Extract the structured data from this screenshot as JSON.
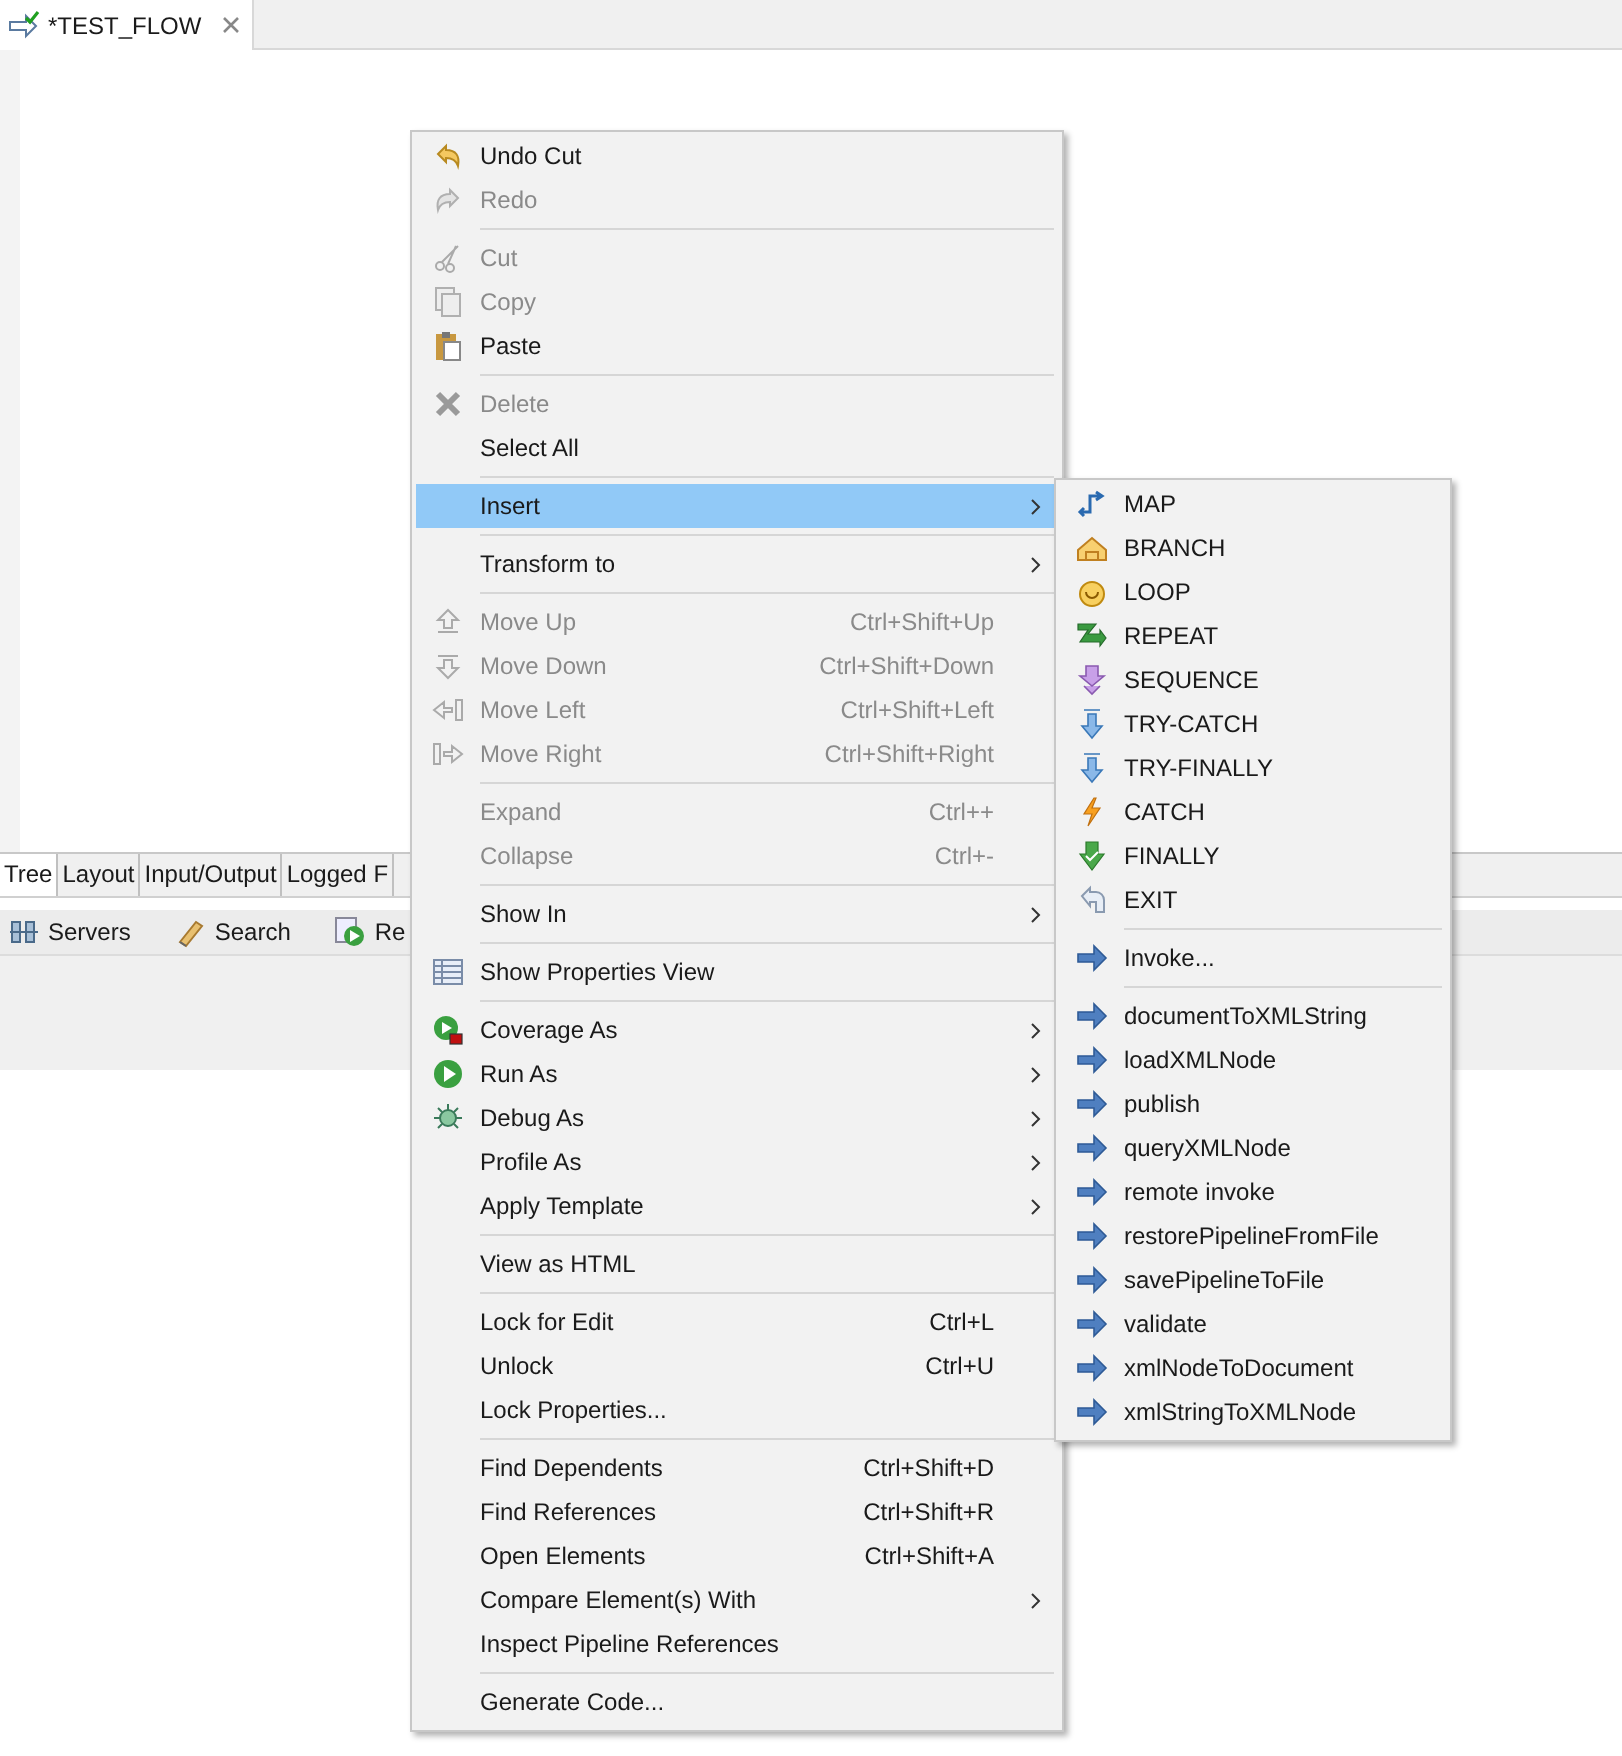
{
  "editor_tab": {
    "title": "*TEST_FLOW",
    "selected": true
  },
  "editor_tabs": [
    {
      "label": "Tree",
      "selected": true
    },
    {
      "label": "Layout",
      "selected": false
    },
    {
      "label": "Input/Output",
      "selected": false
    },
    {
      "label": "Logged F",
      "selected": false
    }
  ],
  "view_tabs": [
    {
      "label": "Servers"
    },
    {
      "label": "Search"
    },
    {
      "label": "Re"
    }
  ],
  "context_menu": [
    {
      "kind": "item",
      "label": "Undo Cut",
      "disabled": false
    },
    {
      "kind": "item",
      "label": "Redo",
      "disabled": true
    },
    {
      "kind": "separator"
    },
    {
      "kind": "item",
      "label": "Cut",
      "disabled": true
    },
    {
      "kind": "item",
      "label": "Copy",
      "disabled": true
    },
    {
      "kind": "item",
      "label": "Paste",
      "disabled": false
    },
    {
      "kind": "separator"
    },
    {
      "kind": "item",
      "label": "Delete",
      "disabled": true
    },
    {
      "kind": "item",
      "label": "Select All",
      "disabled": false
    },
    {
      "kind": "separator"
    },
    {
      "kind": "item",
      "label": "Insert",
      "disabled": false,
      "submenu": true,
      "selected": true
    },
    {
      "kind": "separator"
    },
    {
      "kind": "item",
      "label": "Transform to",
      "disabled": false,
      "submenu": true
    },
    {
      "kind": "separator"
    },
    {
      "kind": "item",
      "label": "Move Up",
      "shortcut": "Ctrl+Shift+Up",
      "disabled": true
    },
    {
      "kind": "item",
      "label": "Move Down",
      "shortcut": "Ctrl+Shift+Down",
      "disabled": true
    },
    {
      "kind": "item",
      "label": "Move Left",
      "shortcut": "Ctrl+Shift+Left",
      "disabled": true
    },
    {
      "kind": "item",
      "label": "Move Right",
      "shortcut": "Ctrl+Shift+Right",
      "disabled": true
    },
    {
      "kind": "separator"
    },
    {
      "kind": "item",
      "label": "Expand",
      "shortcut": "Ctrl++",
      "disabled": true
    },
    {
      "kind": "item",
      "label": "Collapse",
      "shortcut": "Ctrl+-",
      "disabled": true
    },
    {
      "kind": "separator"
    },
    {
      "kind": "item",
      "label": "Show In",
      "disabled": false,
      "submenu": true
    },
    {
      "kind": "separator"
    },
    {
      "kind": "item",
      "label": "Show Properties View",
      "disabled": false
    },
    {
      "kind": "separator"
    },
    {
      "kind": "item",
      "label": "Coverage As",
      "disabled": false,
      "submenu": true
    },
    {
      "kind": "item",
      "label": "Run As",
      "disabled": false,
      "submenu": true
    },
    {
      "kind": "item",
      "label": "Debug As",
      "disabled": false,
      "submenu": true
    },
    {
      "kind": "item",
      "label": "Profile As",
      "disabled": false,
      "submenu": true
    },
    {
      "kind": "item",
      "label": "Apply Template",
      "disabled": false,
      "submenu": true
    },
    {
      "kind": "separator"
    },
    {
      "kind": "item",
      "label": "View as HTML",
      "disabled": false
    },
    {
      "kind": "separator"
    },
    {
      "kind": "item",
      "label": "Lock for Edit",
      "shortcut": "Ctrl+L",
      "disabled": false
    },
    {
      "kind": "item",
      "label": "Unlock",
      "shortcut": "Ctrl+U",
      "disabled": false
    },
    {
      "kind": "item",
      "label": "Lock Properties...",
      "disabled": false
    },
    {
      "kind": "separator"
    },
    {
      "kind": "item",
      "label": "Find Dependents",
      "shortcut": "Ctrl+Shift+D",
      "disabled": false
    },
    {
      "kind": "item",
      "label": "Find References",
      "shortcut": "Ctrl+Shift+R",
      "disabled": false
    },
    {
      "kind": "item",
      "label": "Open Elements",
      "shortcut": "Ctrl+Shift+A",
      "disabled": false
    },
    {
      "kind": "item",
      "label": "Compare Element(s) With",
      "disabled": false,
      "submenu": true
    },
    {
      "kind": "item",
      "label": "Inspect Pipeline References",
      "disabled": false
    },
    {
      "kind": "separator"
    },
    {
      "kind": "item",
      "label": "Generate Code...",
      "disabled": false
    }
  ],
  "insert_submenu": [
    {
      "kind": "item",
      "label": "MAP"
    },
    {
      "kind": "item",
      "label": "BRANCH"
    },
    {
      "kind": "item",
      "label": "LOOP"
    },
    {
      "kind": "item",
      "label": "REPEAT"
    },
    {
      "kind": "item",
      "label": "SEQUENCE"
    },
    {
      "kind": "item",
      "label": "TRY-CATCH"
    },
    {
      "kind": "item",
      "label": "TRY-FINALLY"
    },
    {
      "kind": "item",
      "label": "CATCH"
    },
    {
      "kind": "item",
      "label": "FINALLY"
    },
    {
      "kind": "item",
      "label": "EXIT"
    },
    {
      "kind": "separator"
    },
    {
      "kind": "item",
      "label": "Invoke..."
    },
    {
      "kind": "separator"
    },
    {
      "kind": "item",
      "label": "documentToXMLString"
    },
    {
      "kind": "item",
      "label": "loadXMLNode"
    },
    {
      "kind": "item",
      "label": "publish"
    },
    {
      "kind": "item",
      "label": "queryXMLNode"
    },
    {
      "kind": "item",
      "label": "remote invoke"
    },
    {
      "kind": "item",
      "label": "restorePipelineFromFile"
    },
    {
      "kind": "item",
      "label": "savePipelineToFile"
    },
    {
      "kind": "item",
      "label": "validate"
    },
    {
      "kind": "item",
      "label": "xmlNodeToDocument"
    },
    {
      "kind": "item",
      "label": "xmlStringToXMLNode"
    }
  ]
}
